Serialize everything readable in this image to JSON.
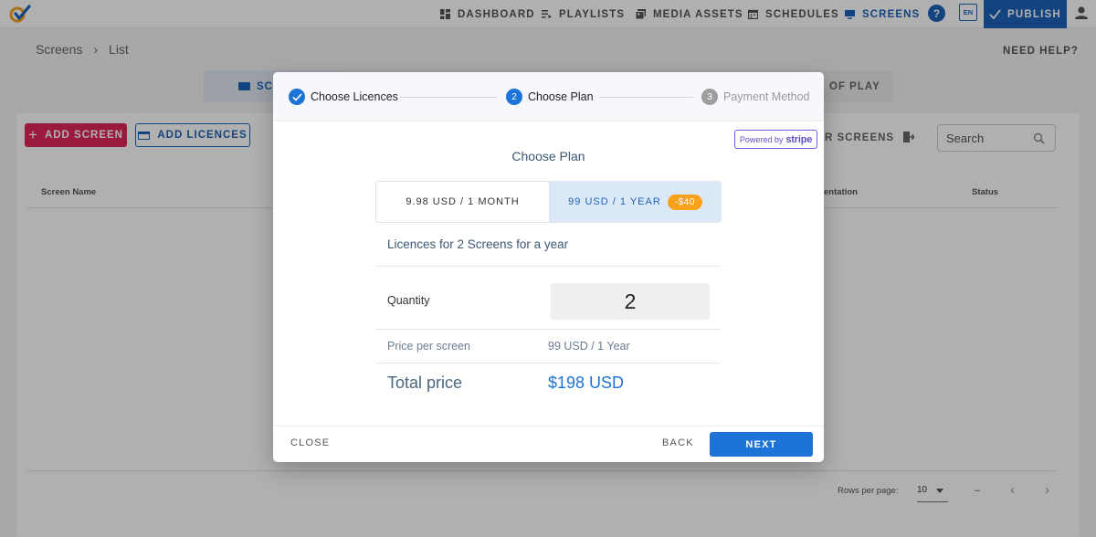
{
  "nav": {
    "items": [
      {
        "label": "DASHBOARD",
        "icon": "dashboard-icon"
      },
      {
        "label": "PLAYLISTS",
        "icon": "playlist-icon"
      },
      {
        "label": "MEDIA ASSETS",
        "icon": "media-icon"
      },
      {
        "label": "SCHEDULES",
        "icon": "calendar-icon"
      },
      {
        "label": "SCREENS",
        "icon": "monitor-icon",
        "active": true
      }
    ],
    "help_label": "?",
    "lang_label": "EN",
    "publish_label": "PUBLISH"
  },
  "page": {
    "breadcrumb": [
      "Screens",
      "List"
    ],
    "need_help": "NEED HELP?",
    "tab_screens": "SC",
    "tab_proof": "OF PLAY",
    "add_screen": "ADD SCREEN",
    "add_licences": "ADD LICENCES",
    "filter_screens": "R SCREENS",
    "search_placeholder": "Search",
    "columns": {
      "name": "Screen Name",
      "orientation": "entation",
      "status": "Status"
    },
    "rows_per_page_label": "Rows per page:",
    "rows_per_page": "10",
    "range": "–"
  },
  "modal": {
    "steps": [
      {
        "label": "Choose Licences",
        "state": "done"
      },
      {
        "num": "2",
        "label": "Choose Plan",
        "state": "current"
      },
      {
        "num": "3",
        "label": "Payment Method",
        "state": "todo"
      }
    ],
    "stripe": {
      "prefix": "Powered by",
      "brand": "stripe"
    },
    "title": "Choose Plan",
    "plans": [
      {
        "label": "9.98 USD / 1 MONTH",
        "selected": false
      },
      {
        "label": "99 USD / 1 YEAR",
        "selected": true,
        "badge": "-$40"
      }
    ],
    "description": "Licences for 2 Screens for a year",
    "quantity_label": "Quantity",
    "quantity": "2",
    "price_per_screen_label": "Price per screen",
    "price_per_screen": "99 USD / 1 Year",
    "total_label": "Total price",
    "total": "$198 USD",
    "close": "CLOSE",
    "back": "BACK",
    "next": "NEXT"
  },
  "colors": {
    "primary": "#1e74d6",
    "brand_blue": "#1e63b8",
    "accent_pink": "#e0265a",
    "badge_orange": "#f7a21a",
    "stripe": "#6b5fdb"
  }
}
